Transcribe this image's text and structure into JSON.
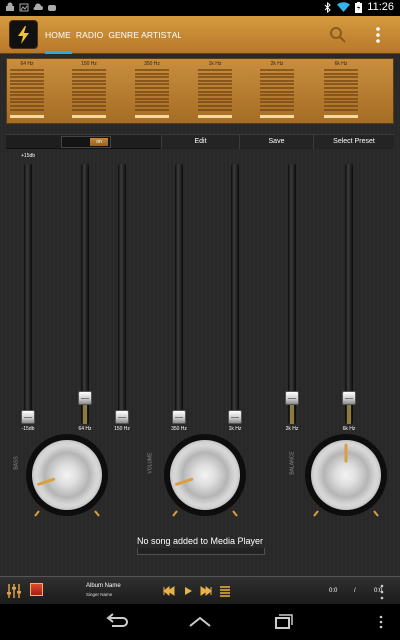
{
  "status_bar": {
    "time": "11:26",
    "left_icons": [
      "android-icon",
      "notification-icon",
      "cloud-icon",
      "gamepad-icon"
    ],
    "right_icons": [
      "bluetooth-icon",
      "wifi-icon",
      "battery-icon"
    ]
  },
  "action_bar": {
    "tabs": [
      {
        "label": "HOME",
        "active": true
      },
      {
        "label": "RADIO",
        "active": false
      },
      {
        "label": "GENRE",
        "active": false
      },
      {
        "label": "ARTIST",
        "active": false
      },
      {
        "label": "ALBUM",
        "active": false
      }
    ],
    "accent": "#2fa8e0",
    "brand_color": "#c98e3e"
  },
  "spectrum": {
    "bands": [
      {
        "label": "64 Hz",
        "level": 0.95
      },
      {
        "label": "150 Hz",
        "level": 0.95
      },
      {
        "label": "350 Hz",
        "level": 0.95
      },
      {
        "label": "1k Hz",
        "level": 0.95
      },
      {
        "label": "2k Hz",
        "level": 0.95
      },
      {
        "label": "6k Hz",
        "level": 0.95
      }
    ]
  },
  "controls": {
    "power_label": "on",
    "edit_label": "Edit",
    "save_label": "Save",
    "preset_label": "Select Preset"
  },
  "equalizer": {
    "max_db_label": "+15db",
    "sliders": [
      {
        "label": "-15db",
        "level": 0.0
      },
      {
        "label": "64 Hz",
        "level": 0.08
      },
      {
        "label": "150 Hz",
        "level": 0.0
      },
      {
        "label": "350 Hz",
        "level": 0.0
      },
      {
        "label": "1k Hz",
        "level": 0.0
      },
      {
        "label": "2k Hz",
        "level": 0.08
      },
      {
        "label": "6k Hz",
        "level": 0.08
      }
    ]
  },
  "knobs": [
    {
      "name": "BASS",
      "value": 0.1
    },
    {
      "name": "VOLUME",
      "value": 0.1
    },
    {
      "name": "BALANCE",
      "value": 0.5
    }
  ],
  "status_message": "No song added to Media Player",
  "player": {
    "album": "Album Name",
    "singer": "Singer Name",
    "current_time": "0:0",
    "separator": "/",
    "total_time": "0:0"
  }
}
